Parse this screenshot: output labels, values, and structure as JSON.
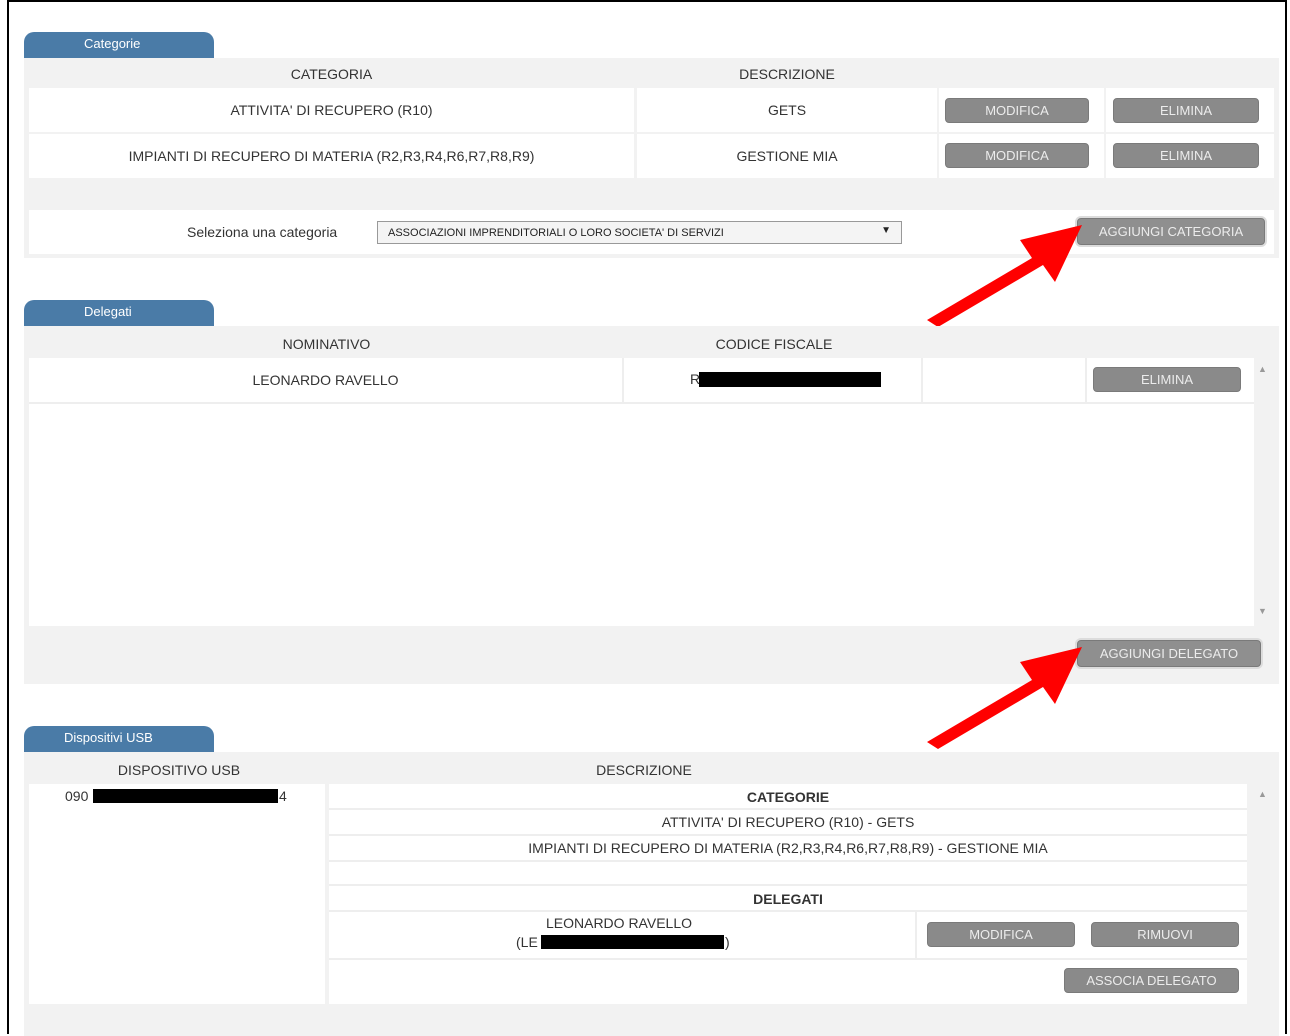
{
  "categorie": {
    "tab_label": "Categorie",
    "col_categoria": "CATEGORIA",
    "col_descrizione": "DESCRIZIONE",
    "rows": [
      {
        "categoria": "ATTIVITA' DI RECUPERO (R10)",
        "descrizione": "GETS"
      },
      {
        "categoria": "IMPIANTI DI RECUPERO DI MATERIA (R2,R3,R4,R6,R7,R8,R9)",
        "descrizione": "GESTIONE MIA"
      }
    ],
    "modify_label": "MODIFICA",
    "delete_label": "ELIMINA",
    "select_label": "Seleziona una categoria",
    "select_value": "ASSOCIAZIONI IMPRENDITORIALI O LORO SOCIETA' DI SERVIZI",
    "add_label": "AGGIUNGI CATEGORIA"
  },
  "delegati": {
    "tab_label": "Delegati",
    "col_nominativo": "NOMINATIVO",
    "col_codice_fiscale": "CODICE FISCALE",
    "rows": [
      {
        "nominativo": "LEONARDO RAVELLO",
        "codice_prefix": "R"
      }
    ],
    "delete_label": "ELIMINA",
    "add_label": "AGGIUNGI DELEGATO"
  },
  "usb": {
    "tab_label": "Dispositivi USB",
    "col_dispositivo": "DISPOSITIVO USB",
    "col_descrizione": "DESCRIZIONE",
    "device_prefix": "090",
    "device_suffix": "4",
    "categorie_header": "CATEGORIE",
    "categorie_items": [
      "ATTIVITA' DI RECUPERO (R10) - GETS",
      "IMPIANTI DI RECUPERO DI MATERIA (R2,R3,R4,R6,R7,R8,R9) - GESTIONE MIA"
    ],
    "delegati_header": "DELEGATI",
    "delegato_name": "LEONARDO RAVELLO",
    "delegato_code_prefix": "(LE",
    "delegato_code_suffix": ")",
    "modify_label": "MODIFICA",
    "remove_label": "RIMUOVI",
    "associate_label": "ASSOCIA DELEGATO"
  },
  "colors": {
    "tab": "#4a7ba7",
    "button": "#8a8a8a",
    "panel": "#f2f2f2",
    "arrow": "#ff0000"
  },
  "icons": [
    "dropdown-arrow-icon",
    "scroll-up-icon",
    "scroll-down-icon",
    "red-arrow-icon"
  ]
}
